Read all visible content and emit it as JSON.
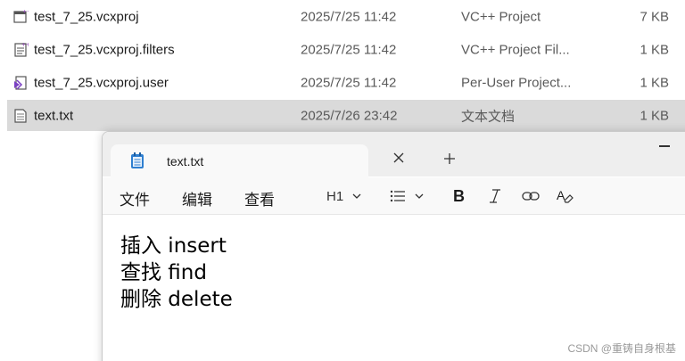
{
  "files": [
    {
      "name": "test_7_25.vcxproj",
      "date": "2025/7/25 11:42",
      "type": "VC++ Project",
      "size": "7 KB",
      "icon": "vcxproj-icon",
      "selected": false
    },
    {
      "name": "test_7_25.vcxproj.filters",
      "date": "2025/7/25 11:42",
      "type": "VC++ Project Fil...",
      "size": "1 KB",
      "icon": "filters-icon",
      "selected": false
    },
    {
      "name": "test_7_25.vcxproj.user",
      "date": "2025/7/25 11:42",
      "type": "Per-User Project...",
      "size": "1 KB",
      "icon": "vs-user-icon",
      "selected": false
    },
    {
      "name": "text.txt",
      "date": "2025/7/26 23:42",
      "type": "文本文档",
      "size": "1 KB",
      "icon": "text-file-icon",
      "selected": true
    }
  ],
  "notepad": {
    "tab_title": "text.txt",
    "menu": {
      "file": "文件",
      "edit": "编辑",
      "view": "查看"
    },
    "heading_label": "H1",
    "content": [
      "插入 insert",
      "查找 find",
      "删除 delete"
    ]
  },
  "watermark": "CSDN @重铸自身根基",
  "colors": {
    "selected_row": "#dadada",
    "titlebar": "#eeeeee",
    "notepad_icon": "#2f7fd0"
  }
}
